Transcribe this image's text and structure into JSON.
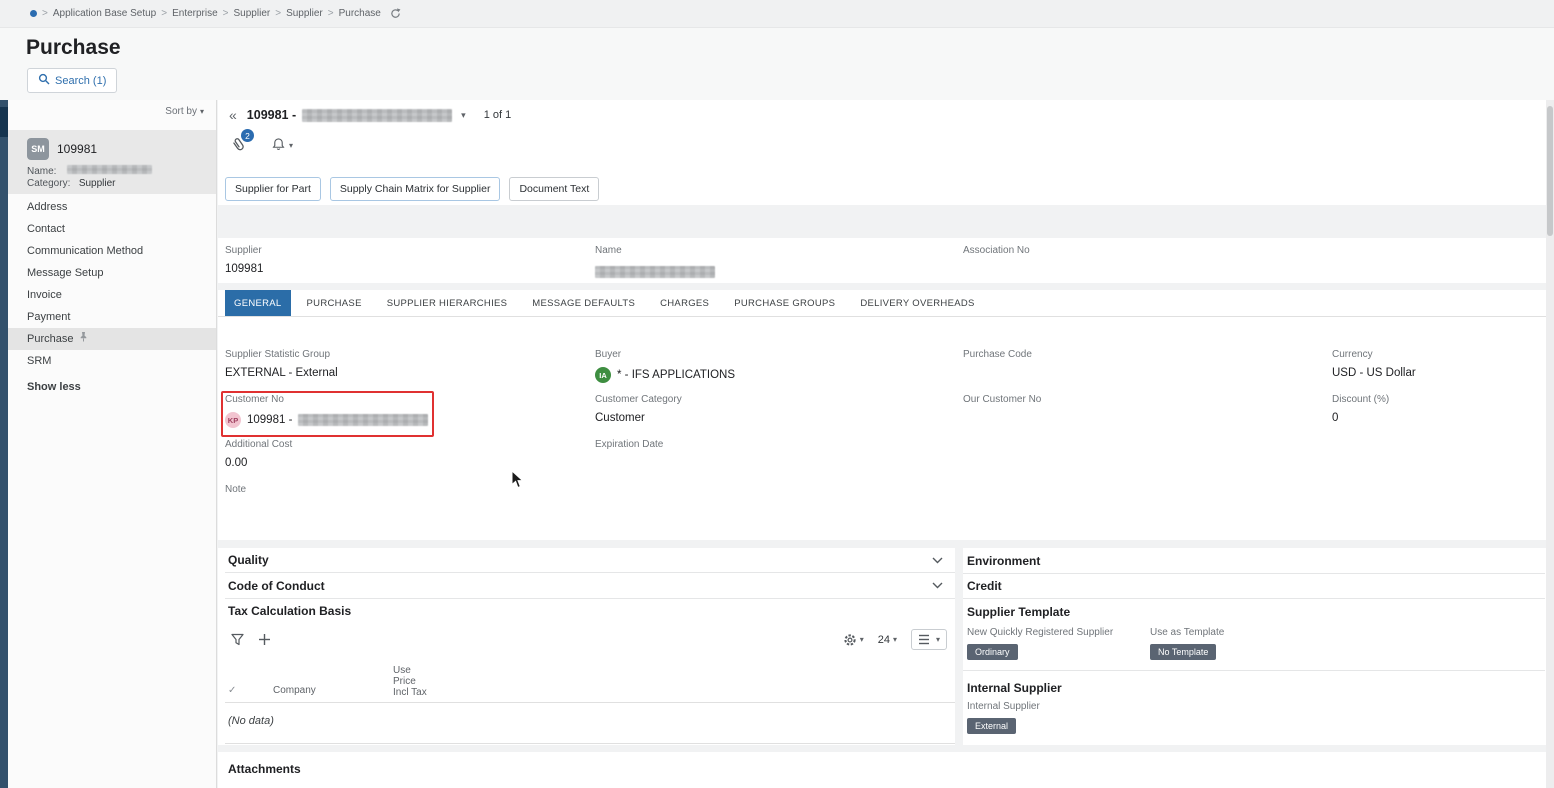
{
  "colors": {
    "accent": "#2f6fad",
    "tab_active_bg": "#2b6da8",
    "badge_bg": "#5a6472",
    "annotation_red": "#e03131"
  },
  "breadcrumb": {
    "items": [
      "Application Base Setup",
      "Enterprise",
      "Supplier",
      "Supplier",
      "Purchase"
    ]
  },
  "page": {
    "title": "Purchase",
    "search_label": "Search (1)"
  },
  "sidebar": {
    "sort_by": "Sort by",
    "card": {
      "avatar": "SM",
      "id": "109981",
      "name_label": "Name:",
      "category_label": "Category:",
      "category_value": "Supplier"
    },
    "items": [
      "Address",
      "Contact",
      "Communication Method",
      "Message Setup",
      "Invoice",
      "Payment",
      "Purchase",
      "SRM"
    ],
    "show_less": "Show less"
  },
  "record": {
    "id_prefix": "109981 -",
    "pager": "1 of 1",
    "attachment_count": "2"
  },
  "commands": [
    "Supplier for Part",
    "Supply Chain Matrix for Supplier",
    "Document Text"
  ],
  "summary": {
    "supplier_label": "Supplier",
    "supplier_value": "109981",
    "name_label": "Name",
    "association_label": "Association No"
  },
  "tabs": [
    "GENERAL",
    "PURCHASE",
    "SUPPLIER HIERARCHIES",
    "MESSAGE DEFAULTS",
    "CHARGES",
    "PURCHASE GROUPS",
    "DELIVERY OVERHEADS"
  ],
  "general": {
    "supplier_statistic_group": {
      "label": "Supplier Statistic Group",
      "value": "EXTERNAL - External"
    },
    "buyer": {
      "label": "Buyer",
      "avatar": "IA",
      "value": "* - IFS APPLICATIONS"
    },
    "purchase_code": {
      "label": "Purchase Code"
    },
    "currency": {
      "label": "Currency",
      "value": "USD - US Dollar"
    },
    "customer_no": {
      "label": "Customer No",
      "avatar": "KP",
      "value_prefix": "109981 -"
    },
    "customer_category": {
      "label": "Customer Category",
      "value": "Customer"
    },
    "our_customer_no": {
      "label": "Our Customer No"
    },
    "discount": {
      "label": "Discount (%)",
      "value": "0"
    },
    "additional_cost": {
      "label": "Additional Cost",
      "value": "0.00"
    },
    "expiration_date": {
      "label": "Expiration Date"
    },
    "note": {
      "label": "Note"
    }
  },
  "sections": {
    "quality": "Quality",
    "code_of_conduct": "Code of Conduct",
    "tax_calculation_basis": "Tax Calculation Basis",
    "environment": "Environment",
    "credit": "Credit",
    "supplier_template": "Supplier Template",
    "internal_supplier": "Internal Supplier",
    "attachments": "Attachments"
  },
  "tax_table": {
    "page_size": "24",
    "check_glyph": "✓",
    "col_company": "Company",
    "col_use": "Use",
    "col_price": "Price",
    "col_incl_tax": "Incl Tax",
    "no_data": "(No data)"
  },
  "supplier_template": {
    "field1_label": "New Quickly Registered Supplier",
    "field1_badge": "Ordinary",
    "field2_label": "Use as Template",
    "field2_badge": "No Template"
  },
  "internal_supplier": {
    "label": "Internal Supplier",
    "badge": "External"
  }
}
